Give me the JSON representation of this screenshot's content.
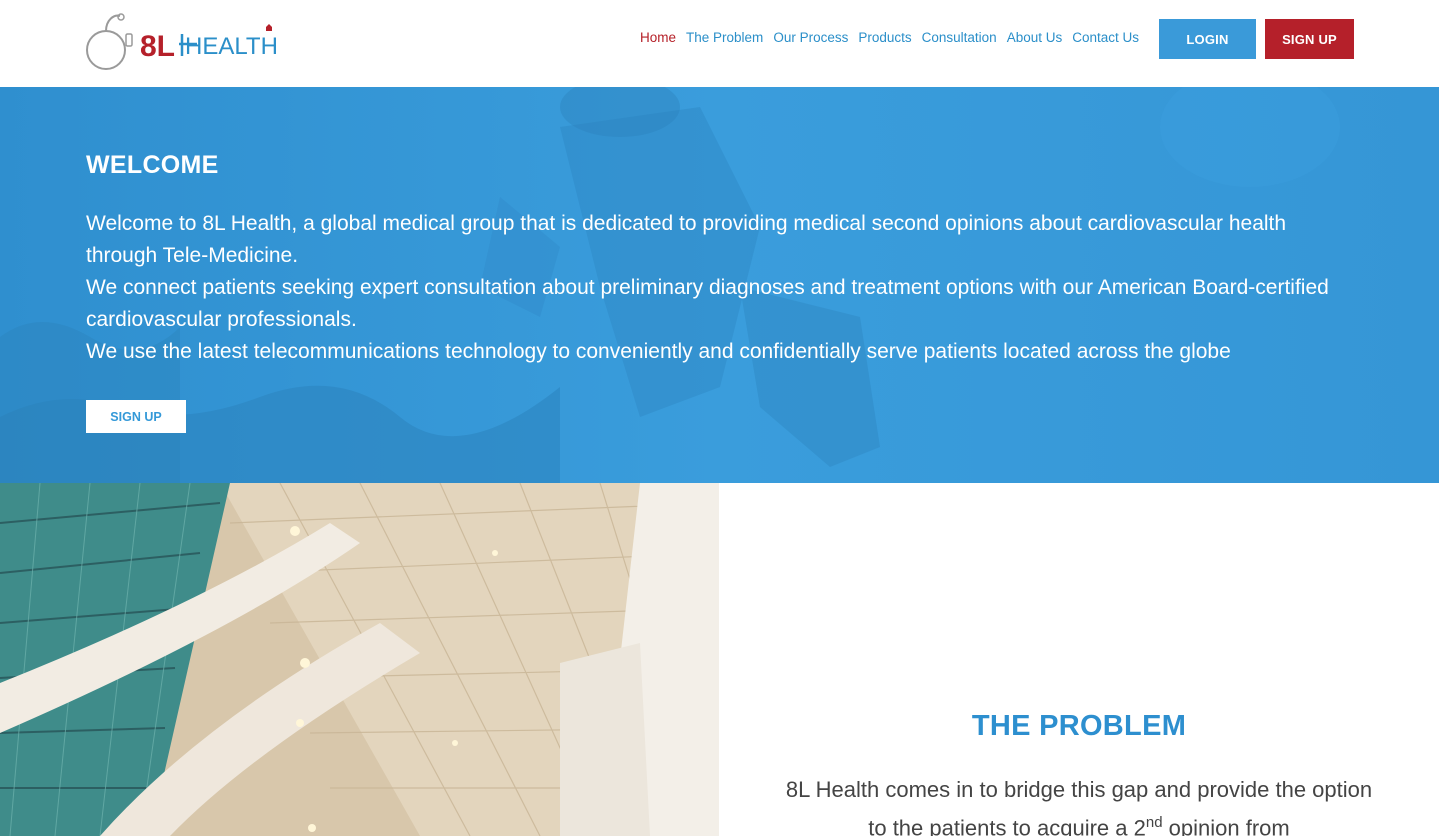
{
  "header": {
    "logo_text": "8L HEALTH",
    "nav": [
      {
        "label": "Home",
        "active": true
      },
      {
        "label": "The Problem",
        "active": false
      },
      {
        "label": "Our Process",
        "active": false
      },
      {
        "label": "Products",
        "active": false
      },
      {
        "label": "Consultation",
        "active": false
      },
      {
        "label": "About Us",
        "active": false
      },
      {
        "label": "Contact Us",
        "active": false
      }
    ],
    "login_label": "LOGIN",
    "signup_label": "SIGN UP"
  },
  "hero": {
    "title": "WELCOME",
    "paragraphs": [
      "Welcome to 8L Health, a global medical group that is dedicated to providing medical second opinions about cardiovascular health through Tele-Medicine.",
      "We connect patients seeking expert consultation about preliminary diagnoses and treatment options with our American Board-certified cardiovascular professionals.",
      "We use the latest telecommunications technology to conveniently and confidentially serve patients located across the globe"
    ],
    "signup_label": "SIGN UP"
  },
  "problem": {
    "title": "THE PROBLEM",
    "text_before": "8L Health comes in to bridge this gap and provide the option to the patients to acquire a 2",
    "text_sup": "nd",
    "text_after": " opinion from"
  },
  "colors": {
    "brand_blue": "#3499d8",
    "brand_red": "#b5202a",
    "nav_blue": "#2b8fc9"
  }
}
